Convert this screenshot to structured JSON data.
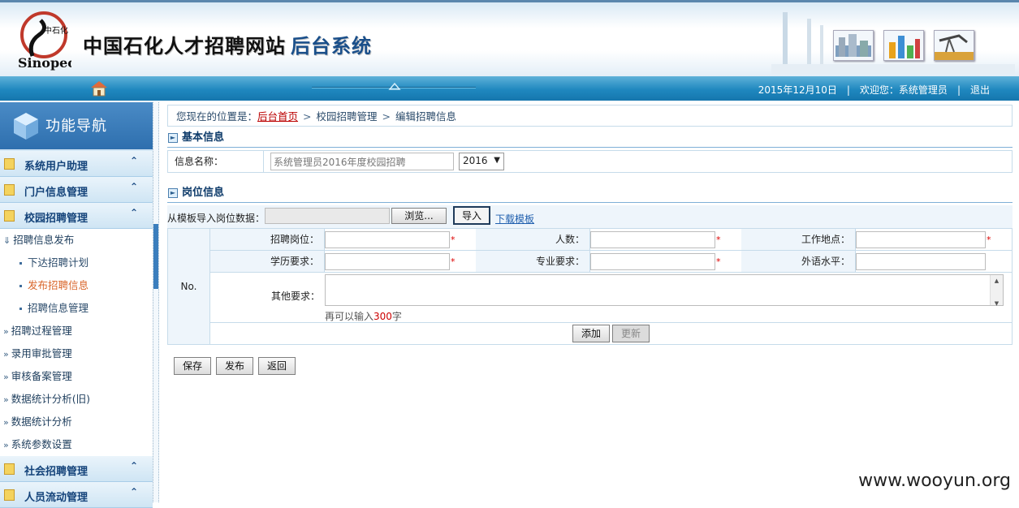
{
  "header": {
    "title": "中国石化人才招聘网站",
    "subtitle": "后台系统"
  },
  "topbar": {
    "date": "2015年12月10日",
    "welcome": "欢迎您：系统管理员",
    "logout": "退出"
  },
  "sidebar": {
    "title": "功能导航",
    "groups": [
      {
        "label": "系统用户助理"
      },
      {
        "label": "门户信息管理"
      },
      {
        "label": "校园招聘管理"
      },
      {
        "label": "社会招聘管理"
      },
      {
        "label": "人员流动管理"
      }
    ],
    "items": [
      {
        "label": "招聘信息发布"
      },
      {
        "label": "下达招聘计划"
      },
      {
        "label": "发布招聘信息"
      },
      {
        "label": "招聘信息管理"
      },
      {
        "label": "招聘过程管理"
      },
      {
        "label": "录用审批管理"
      },
      {
        "label": "审核备案管理"
      },
      {
        "label": "数据统计分析(旧)"
      },
      {
        "label": "数据统计分析"
      },
      {
        "label": "系统参数设置"
      }
    ]
  },
  "breadcrumb": {
    "prefix": "您现在的位置是：",
    "home": "后台首页",
    "level1": "校园招聘管理",
    "level2": "编辑招聘信息",
    "sep": ">"
  },
  "basic": {
    "heading": "基本信息",
    "name_label": "信息名称：",
    "name_value": "系统管理员2016年度校园招聘",
    "year": "2016"
  },
  "jobs": {
    "heading": "岗位信息",
    "import_label": "从模板导入岗位数据：",
    "browse": "浏览...",
    "import": "导入",
    "download": "下载模板",
    "no": "No.",
    "position": "招聘岗位：",
    "count": "人数：",
    "location": "工作地点：",
    "education": "学历要求：",
    "major": "专业要求：",
    "language": "外语水平：",
    "other": "其他要求：",
    "remain_prefix": "再可以输入",
    "remain_count": "300",
    "remain_suffix": "字",
    "required_mark": "*",
    "add": "添加",
    "update": "更新"
  },
  "actions": {
    "save": "保存",
    "publish": "发布",
    "back": "返回"
  },
  "watermark": "www.wooyun.org"
}
